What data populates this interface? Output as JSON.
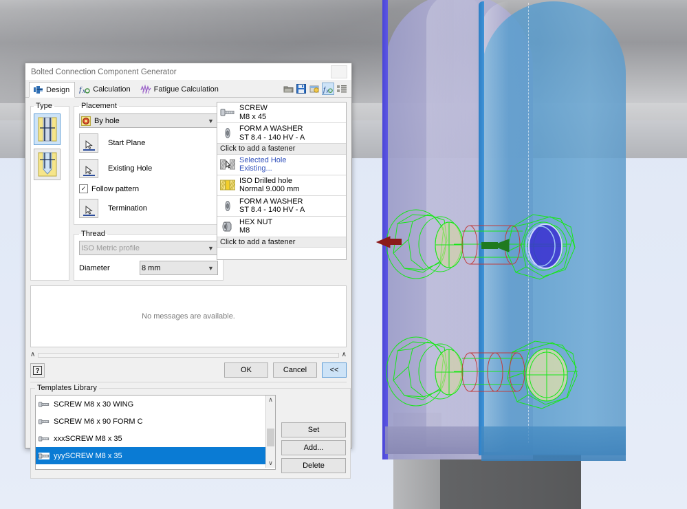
{
  "window": {
    "title": "Bolted Connection Component Generator",
    "close_label": ""
  },
  "tabs": [
    {
      "label": "Design",
      "icon": "design-icon",
      "selected": true
    },
    {
      "label": "Calculation",
      "icon": "fx-icon",
      "selected": false
    },
    {
      "label": "Fatigue Calculation",
      "icon": "fatigue-icon",
      "selected": false
    }
  ],
  "toolbar": [
    {
      "name": "open-icon",
      "label": "Open"
    },
    {
      "name": "save-icon",
      "label": "Save"
    },
    {
      "name": "export-icon",
      "label": "Export"
    },
    {
      "name": "fx-icon",
      "label": "fx",
      "active": true
    },
    {
      "name": "list-icon",
      "label": "List"
    }
  ],
  "type": {
    "legend": "Type",
    "options": [
      {
        "name": "through-bolt",
        "selected": true
      },
      {
        "name": "blind-hole-bolt",
        "selected": false
      }
    ]
  },
  "placement": {
    "legend": "Placement",
    "mode": "By hole",
    "start_plane": "Start Plane",
    "existing_hole": "Existing Hole",
    "follow_pattern": "Follow pattern",
    "follow_pattern_checked": "✓",
    "termination": "Termination"
  },
  "thread": {
    "legend": "Thread",
    "profile": "ISO Metric profile",
    "diameter_label": "Diameter",
    "diameter": "8 mm"
  },
  "fasteners": [
    {
      "title": "SCREW",
      "sub": "M8 x 45",
      "icon": "screw-icon",
      "kind": "item"
    },
    {
      "title": "FORM A WASHER",
      "sub": "ST 8.4 - 140 HV - A",
      "icon": "washer-icon",
      "kind": "item"
    },
    {
      "title": "Click to add a fastener",
      "sub": "",
      "icon": "",
      "kind": "add"
    },
    {
      "title": "Selected Hole",
      "sub": "Existing...",
      "icon": "hole-icon",
      "kind": "link"
    },
    {
      "title": "ISO Drilled hole",
      "sub": "Normal 9.000 mm",
      "icon": "drilled-hole-icon",
      "kind": "item"
    },
    {
      "title": "FORM A WASHER",
      "sub": "ST 8.4 - 140 HV - A",
      "icon": "washer-icon",
      "kind": "item"
    },
    {
      "title": "HEX NUT",
      "sub": "M8",
      "icon": "nut-icon",
      "kind": "item"
    },
    {
      "title": "Click to add a fastener",
      "sub": "",
      "icon": "",
      "kind": "add"
    }
  ],
  "messages": {
    "text": "No messages are available."
  },
  "buttons": {
    "help": "?",
    "ok": "OK",
    "cancel": "Cancel",
    "collapse": "<<"
  },
  "templates": {
    "legend": "Templates Library",
    "items": [
      {
        "label": "SCREW M8 x 30 WING",
        "selected": false
      },
      {
        "label": "SCREW M6 x 90 FORM C",
        "selected": false
      },
      {
        "label": "xxxSCREW M8 x 35",
        "selected": false
      },
      {
        "label": "yyySCREW M8 x 35",
        "selected": true
      }
    ],
    "actions": [
      {
        "label": "Set"
      },
      {
        "label": "Add..."
      },
      {
        "label": "Delete"
      }
    ],
    "scroll_up": "∧",
    "scroll_down": "∨"
  },
  "splitter": {
    "left_chevron": "∧",
    "right_chevron": "∧"
  },
  "colors": {
    "selection_blue": "#0a7bd4",
    "accent_highlight": "#cde3f7",
    "link_text": "#2f4fbb",
    "wireframe_green": "#17e817",
    "wireframe_red": "#c03c3c",
    "arrow_red": "#8b1a1a",
    "plate_lavender": "#aaa9cf",
    "plate_blue": "#5c9dcd"
  }
}
